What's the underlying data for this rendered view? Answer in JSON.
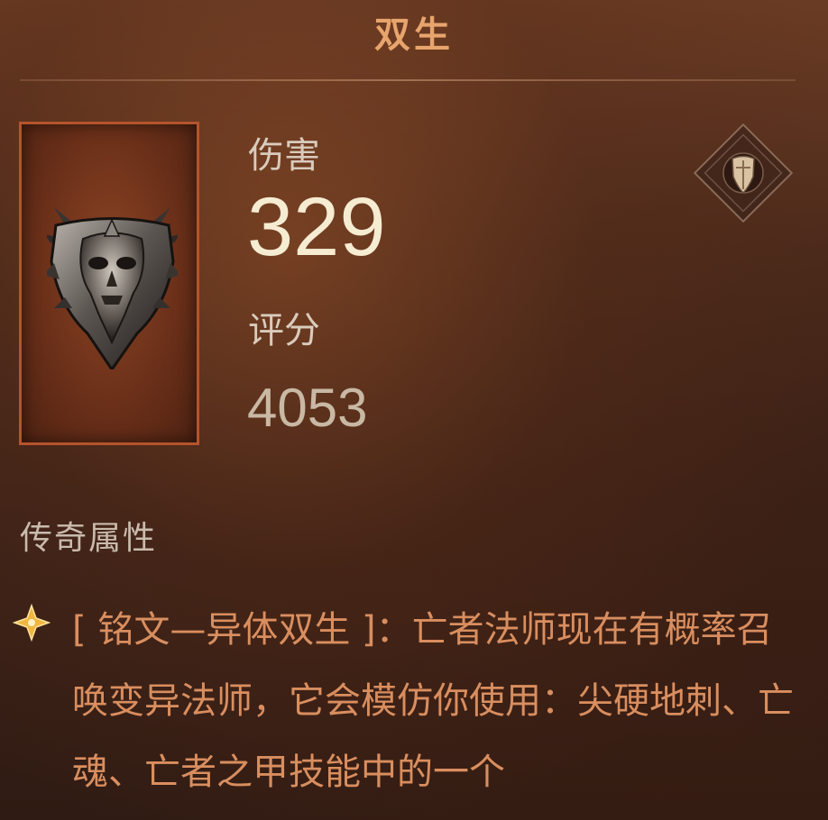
{
  "item": {
    "name": "双生",
    "damage_label": "伤害",
    "damage_value": "329",
    "score_label": "评分",
    "score_value": "4053",
    "slot_icon": "shield-icon",
    "image_icon": "demonic-shield-icon"
  },
  "affix": {
    "section_title": "传奇属性",
    "bullet_icon": "legendary-star-icon",
    "description": "[ 铭文—异体双生 ]：亡者法师现在有概率召唤变异法师，它会模仿你使用：尖硬地刺、亡魂、亡者之甲技能中的一个"
  },
  "colors": {
    "title": "#e7a56d",
    "damage": "#f6ecd2",
    "frame_border": "#b5542c",
    "affix_text": "#d98e5f"
  }
}
